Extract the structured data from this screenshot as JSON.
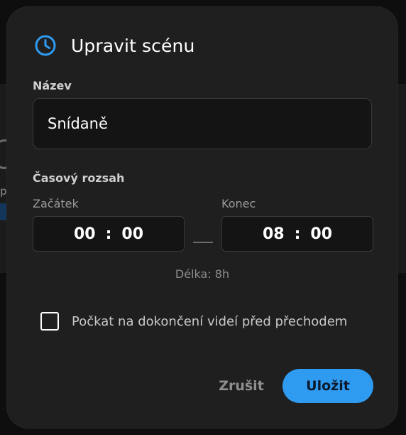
{
  "dialog": {
    "title": "Upravit scénu",
    "title_icon": "clock-icon",
    "accent_color": "#2f9bf0"
  },
  "name_section": {
    "label": "Název",
    "value": "Snídaně"
  },
  "time_range": {
    "label": "Časový rozsah",
    "start": {
      "label": "Začátek",
      "hours": "00",
      "minutes": "00",
      "separator": ":"
    },
    "end": {
      "label": "Konec",
      "hours": "08",
      "minutes": "00",
      "separator": ":"
    },
    "duration": "Délka: 8h"
  },
  "wait_option": {
    "label": "Počkat na dokončení videí před přechodem",
    "checked": false
  },
  "actions": {
    "cancel_label": "Zrušit",
    "save_label": "Uložit"
  },
  "background": {
    "partial_letter": "p"
  }
}
